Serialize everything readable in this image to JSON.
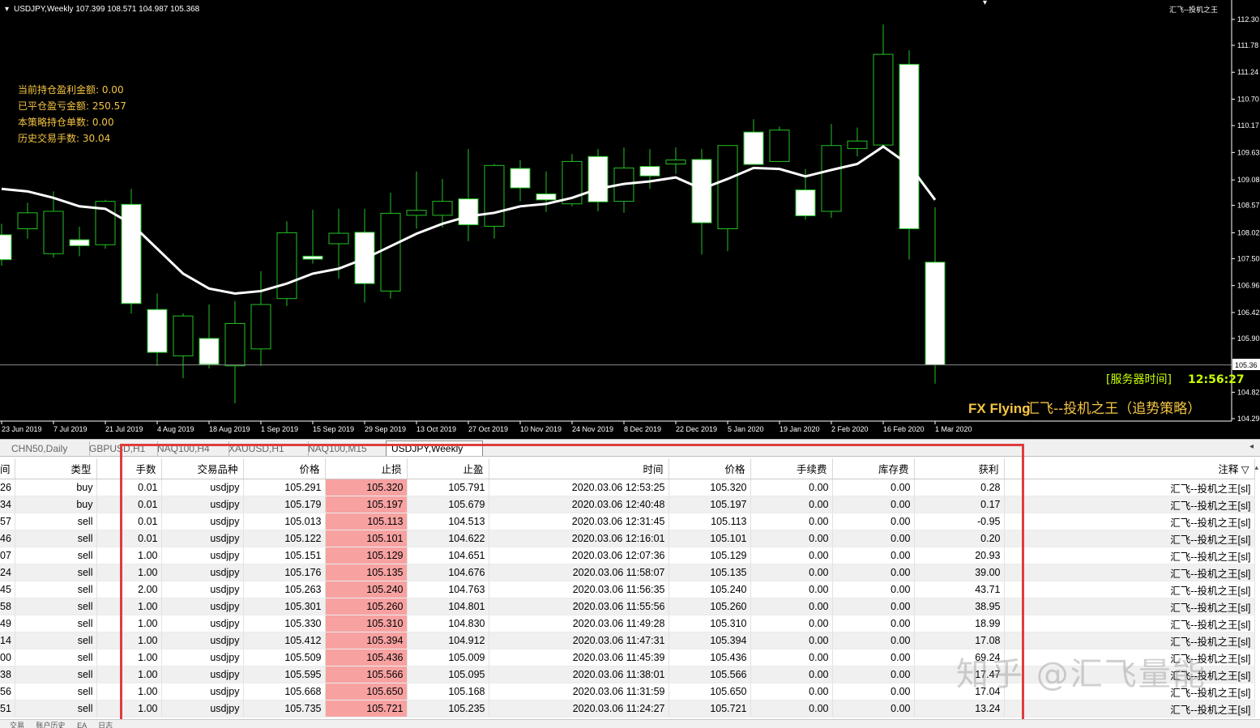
{
  "chart": {
    "title": "USDJPY,Weekly  107.399 108.571 104.987 105.368",
    "top_right_label": "汇飞--投机之王",
    "info_lines": [
      "当前持仓盈利金额: 0.00",
      "已平仓盈亏金额: 250.57",
      "本策略持仓单数: 0.00",
      "历史交易手数: 30.04"
    ],
    "server_time_label": "[服务器时间]",
    "server_time": "12:56:27",
    "brand_en": "FX Flying",
    "brand_cn": "汇飞--投机之王（追势策略）",
    "current_price": "105.368",
    "current_price_label": "105.36",
    "price_ticks": [
      "112.30",
      "111.78",
      "111.24",
      "110.70",
      "110.17",
      "109.63",
      "109.08",
      "108.57",
      "108.02",
      "107.50",
      "106.96",
      "106.42",
      "105.90",
      "104.82",
      "104.29"
    ],
    "date_ticks": [
      "23 Jun 2019",
      "7 Jul 2019",
      "21 Jul 2019",
      "4 Aug 2019",
      "18 Aug 2019",
      "1 Sep 2019",
      "15 Sep 2019",
      "29 Sep 2019",
      "13 Oct 2019",
      "27 Oct 2019",
      "10 Nov 2019",
      "24 Nov 2019",
      "8 Dec 2019",
      "22 Dec 2019",
      "5 Jan 2020",
      "19 Jan 2020",
      "2 Feb 2020",
      "16 Feb 2020",
      "1 Mar 2020"
    ],
    "candles": [
      [
        107.98,
        108.2,
        107.36,
        107.48
      ],
      [
        108.1,
        108.62,
        107.9,
        108.42
      ],
      [
        107.6,
        108.85,
        107.52,
        108.45
      ],
      [
        107.88,
        108.14,
        107.55,
        107.76
      ],
      [
        107.78,
        108.68,
        107.7,
        108.65
      ],
      [
        108.59,
        108.9,
        106.4,
        106.6
      ],
      [
        106.48,
        106.8,
        105.35,
        105.62
      ],
      [
        105.55,
        106.4,
        105.1,
        106.35
      ],
      [
        105.9,
        106.58,
        105.3,
        105.38
      ],
      [
        105.35,
        106.65,
        104.6,
        106.2
      ],
      [
        105.69,
        107.25,
        105.35,
        106.58
      ],
      [
        106.7,
        108.25,
        106.55,
        108.02
      ],
      [
        107.55,
        108.48,
        107.4,
        107.49
      ],
      [
        107.8,
        108.5,
        107.1,
        108.01
      ],
      [
        108.03,
        108.5,
        106.62,
        107.0
      ],
      [
        106.85,
        108.82,
        106.7,
        108.41
      ],
      [
        108.37,
        109.25,
        108.1,
        108.47
      ],
      [
        108.37,
        109.1,
        108.12,
        108.65
      ],
      [
        108.7,
        109.7,
        107.85,
        108.18
      ],
      [
        108.15,
        109.4,
        107.9,
        109.37
      ],
      [
        109.31,
        109.48,
        108.65,
        108.92
      ],
      [
        108.8,
        109.25,
        108.44,
        108.68
      ],
      [
        108.6,
        109.6,
        108.55,
        109.45
      ],
      [
        109.55,
        109.7,
        108.45,
        108.64
      ],
      [
        108.65,
        109.73,
        108.42,
        109.32
      ],
      [
        109.35,
        109.7,
        108.9,
        109.16
      ],
      [
        109.4,
        109.73,
        109.2,
        109.48
      ],
      [
        109.49,
        109.7,
        107.58,
        108.22
      ],
      [
        108.1,
        109.55,
        107.65,
        109.77
      ],
      [
        110.04,
        110.3,
        109.42,
        109.39
      ],
      [
        109.45,
        110.15,
        109.55,
        110.08
      ],
      [
        108.88,
        109.3,
        108.28,
        108.36
      ],
      [
        108.45,
        110.2,
        108.32,
        109.77
      ],
      [
        109.71,
        110.13,
        109.55,
        109.86
      ],
      [
        109.78,
        112.2,
        109.8,
        111.6
      ],
      [
        111.4,
        111.68,
        107.48,
        108.1
      ],
      [
        107.43,
        108.53,
        104.99,
        105.37
      ]
    ],
    "ma": [
      108.9,
      108.85,
      108.72,
      108.55,
      108.5,
      108.2,
      107.7,
      107.2,
      106.9,
      106.8,
      106.85,
      107.0,
      107.2,
      107.3,
      107.5,
      107.75,
      108.0,
      108.2,
      108.35,
      108.42,
      108.55,
      108.6,
      108.72,
      108.9,
      109.0,
      109.05,
      109.13,
      108.9,
      109.1,
      109.32,
      109.3,
      109.15,
      109.28,
      109.4,
      109.75,
      109.38,
      108.68
    ]
  },
  "tabs": [
    "CHN50,Daily",
    "GBPUSD,H1",
    "NAQ100,H4",
    "XAUUSD,H1",
    "NAQ100,M15",
    "USDJPY,Weekly"
  ],
  "active_tab": "USDJPY,Weekly",
  "table": {
    "columns": [
      "间",
      "类型",
      "手数",
      "交易品种",
      "价格",
      "止损",
      "止盈",
      "时间",
      "价格",
      "手续费",
      "库存费",
      "获利",
      "注释 ▽"
    ],
    "rows": [
      [
        "26",
        "buy",
        "0.01",
        "usdjpy",
        "105.291",
        "105.320",
        "105.791",
        "2020.03.06 12:53:25",
        "105.320",
        "0.00",
        "0.00",
        "0.28",
        "汇飞--投机之王[sl]"
      ],
      [
        "34",
        "buy",
        "0.01",
        "usdjpy",
        "105.179",
        "105.197",
        "105.679",
        "2020.03.06 12:40:48",
        "105.197",
        "0.00",
        "0.00",
        "0.17",
        "汇飞--投机之王[sl]"
      ],
      [
        "57",
        "sell",
        "0.01",
        "usdjpy",
        "105.013",
        "105.113",
        "104.513",
        "2020.03.06 12:31:45",
        "105.113",
        "0.00",
        "0.00",
        "-0.95",
        "汇飞--投机之王[sl]"
      ],
      [
        "46",
        "sell",
        "0.01",
        "usdjpy",
        "105.122",
        "105.101",
        "104.622",
        "2020.03.06 12:16:01",
        "105.101",
        "0.00",
        "0.00",
        "0.20",
        "汇飞--投机之王[sl]"
      ],
      [
        "07",
        "sell",
        "1.00",
        "usdjpy",
        "105.151",
        "105.129",
        "104.651",
        "2020.03.06 12:07:36",
        "105.129",
        "0.00",
        "0.00",
        "20.93",
        "汇飞--投机之王[sl]"
      ],
      [
        "24",
        "sell",
        "1.00",
        "usdjpy",
        "105.176",
        "105.135",
        "104.676",
        "2020.03.06 11:58:07",
        "105.135",
        "0.00",
        "0.00",
        "39.00",
        "汇飞--投机之王[sl]"
      ],
      [
        "45",
        "sell",
        "2.00",
        "usdjpy",
        "105.263",
        "105.240",
        "104.763",
        "2020.03.06 11:56:35",
        "105.240",
        "0.00",
        "0.00",
        "43.71",
        "汇飞--投机之王[sl]"
      ],
      [
        "58",
        "sell",
        "1.00",
        "usdjpy",
        "105.301",
        "105.260",
        "104.801",
        "2020.03.06 11:55:56",
        "105.260",
        "0.00",
        "0.00",
        "38.95",
        "汇飞--投机之王[sl]"
      ],
      [
        "49",
        "sell",
        "1.00",
        "usdjpy",
        "105.330",
        "105.310",
        "104.830",
        "2020.03.06 11:49:28",
        "105.310",
        "0.00",
        "0.00",
        "18.99",
        "汇飞--投机之王[sl]"
      ],
      [
        "14",
        "sell",
        "1.00",
        "usdjpy",
        "105.412",
        "105.394",
        "104.912",
        "2020.03.06 11:47:31",
        "105.394",
        "0.00",
        "0.00",
        "17.08",
        "汇飞--投机之王[sl]"
      ],
      [
        "00",
        "sell",
        "1.00",
        "usdjpy",
        "105.509",
        "105.436",
        "105.009",
        "2020.03.06 11:45:39",
        "105.436",
        "0.00",
        "0.00",
        "69.24",
        "汇飞--投机之王[sl]"
      ],
      [
        "38",
        "sell",
        "1.00",
        "usdjpy",
        "105.595",
        "105.566",
        "105.095",
        "2020.03.06 11:38:01",
        "105.566",
        "0.00",
        "0.00",
        "17.47",
        "汇飞--投机之王[sl]"
      ],
      [
        "56",
        "sell",
        "1.00",
        "usdjpy",
        "105.668",
        "105.650",
        "105.168",
        "2020.03.06 11:31:59",
        "105.650",
        "0.00",
        "0.00",
        "17.04",
        "汇飞--投机之王[sl]"
      ],
      [
        "51",
        "sell",
        "1.00",
        "usdjpy",
        "105.735",
        "105.721",
        "105.235",
        "2020.03.06 11:24:27",
        "105.721",
        "0.00",
        "0.00",
        "13.24",
        "汇飞--投机之王[sl]"
      ]
    ]
  },
  "watermark": "知乎 @汇飞量能",
  "bottom_tabs": [
    "交易",
    "账户历史",
    "EA",
    "日志"
  ],
  "colors": {
    "bull_outline": "#22c322",
    "bear_fill": "#ffffff",
    "ma_line": "#ffffff",
    "stoploss_cell": "#f7a1a1",
    "highlight_box": "#e03c3c",
    "server_time": "#c8ff00",
    "brand": "#f4c542"
  }
}
